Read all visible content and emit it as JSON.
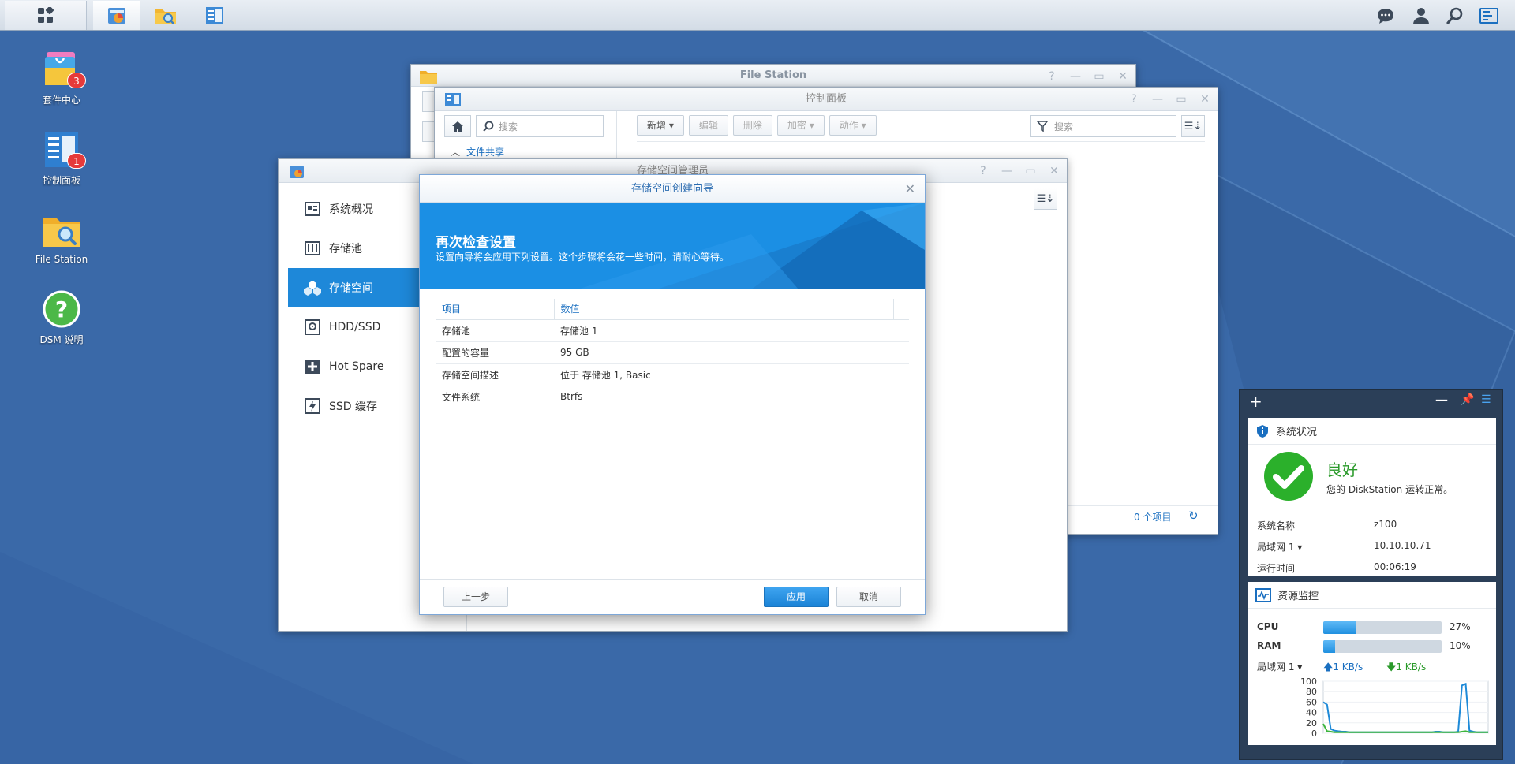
{
  "desktop": {
    "icons": [
      {
        "label": "套件中心",
        "badge": "3"
      },
      {
        "label": "控制面板",
        "badge": "1"
      },
      {
        "label": "File Station",
        "badge": ""
      },
      {
        "label": "DSM 说明",
        "badge": ""
      }
    ]
  },
  "taskbar": {
    "icons": [
      "main-menu-icon",
      "storage-manager-icon",
      "file-station-icon",
      "control-panel-icon"
    ],
    "right_icons": [
      "chat-icon",
      "user-icon",
      "search-icon",
      "widgets-icon"
    ]
  },
  "file_station": {
    "title": "File Station"
  },
  "control_panel": {
    "title": "控制面板",
    "search_placeholder": "搜索",
    "section": "文件共享",
    "toolbar": {
      "new": "新增",
      "edit": "编辑",
      "delete": "删除",
      "encrypt": "加密",
      "action": "动作"
    },
    "filter_placeholder": "搜索",
    "item_count": "0 个项目"
  },
  "storage_manager": {
    "title": "存储空间管理员",
    "sidebar": [
      {
        "label": "系统概况",
        "icon": "overview-icon"
      },
      {
        "label": "存储池",
        "icon": "storage-pool-icon"
      },
      {
        "label": "存储空间",
        "icon": "volume-icon"
      },
      {
        "label": "HDD/SSD",
        "icon": "hdd-icon"
      },
      {
        "label": "Hot Spare",
        "icon": "hot-spare-icon"
      },
      {
        "label": "SSD 缓存",
        "icon": "ssd-cache-icon"
      }
    ],
    "selected": "存储空间"
  },
  "wizard": {
    "title": "存储空间创建向导",
    "heading": "再次检查设置",
    "subheading": "设置向导将会应用下列设置。这个步骤将会花一些时间，请耐心等待。",
    "columns": [
      "项目",
      "数值"
    ],
    "rows": [
      [
        "存储池",
        "存储池 1"
      ],
      [
        "配置的容量",
        "95 GB"
      ],
      [
        "存储空间描述",
        "位于 存储池 1, Basic"
      ],
      [
        "文件系统",
        "Btrfs"
      ]
    ],
    "back_label": "上一步",
    "apply_label": "应用",
    "cancel_label": "取消"
  },
  "system_status": {
    "title": "系统状况",
    "state": "良好",
    "message": "您的 DiskStation 运转正常。",
    "rows": [
      {
        "key": "系统名称",
        "value": "z100"
      },
      {
        "key": "局域网 1",
        "value": "10.10.10.71"
      },
      {
        "key": "运行时间",
        "value": "00:06:19"
      }
    ]
  },
  "resource_monitor": {
    "title": "资源监控",
    "cpu_label": "CPU",
    "cpu_value": "27%",
    "cpu_pct": 27,
    "ram_label": "RAM",
    "ram_value": "10%",
    "ram_pct": 10,
    "lan_label": "局域网 1",
    "upload": "1 KB/s",
    "download": "1 KB/s"
  },
  "chart_data": {
    "type": "line",
    "yticks": [
      "100",
      "80",
      "60",
      "40",
      "20",
      "0"
    ],
    "ylim": [
      0,
      100
    ],
    "series": [
      {
        "color": "#1e8ad8",
        "values": [
          60,
          55,
          8,
          5,
          4,
          3,
          3,
          2,
          2,
          2,
          2,
          2,
          2,
          2,
          2,
          2,
          2,
          2,
          2,
          2,
          2,
          2,
          2,
          2,
          2,
          2,
          2,
          2,
          2,
          2,
          3,
          3,
          2,
          2,
          2,
          2,
          3,
          92,
          95,
          5,
          3,
          2,
          2,
          2,
          2
        ]
      },
      {
        "color": "#3db53d",
        "values": [
          18,
          4,
          3,
          2,
          2,
          2,
          2,
          2,
          2,
          2,
          2,
          2,
          2,
          2,
          2,
          2,
          2,
          2,
          2,
          2,
          2,
          2,
          2,
          2,
          2,
          2,
          2,
          2,
          2,
          2,
          2,
          2,
          2,
          2,
          2,
          2,
          2,
          3,
          4,
          2,
          2,
          2,
          2,
          2,
          2
        ]
      }
    ]
  }
}
